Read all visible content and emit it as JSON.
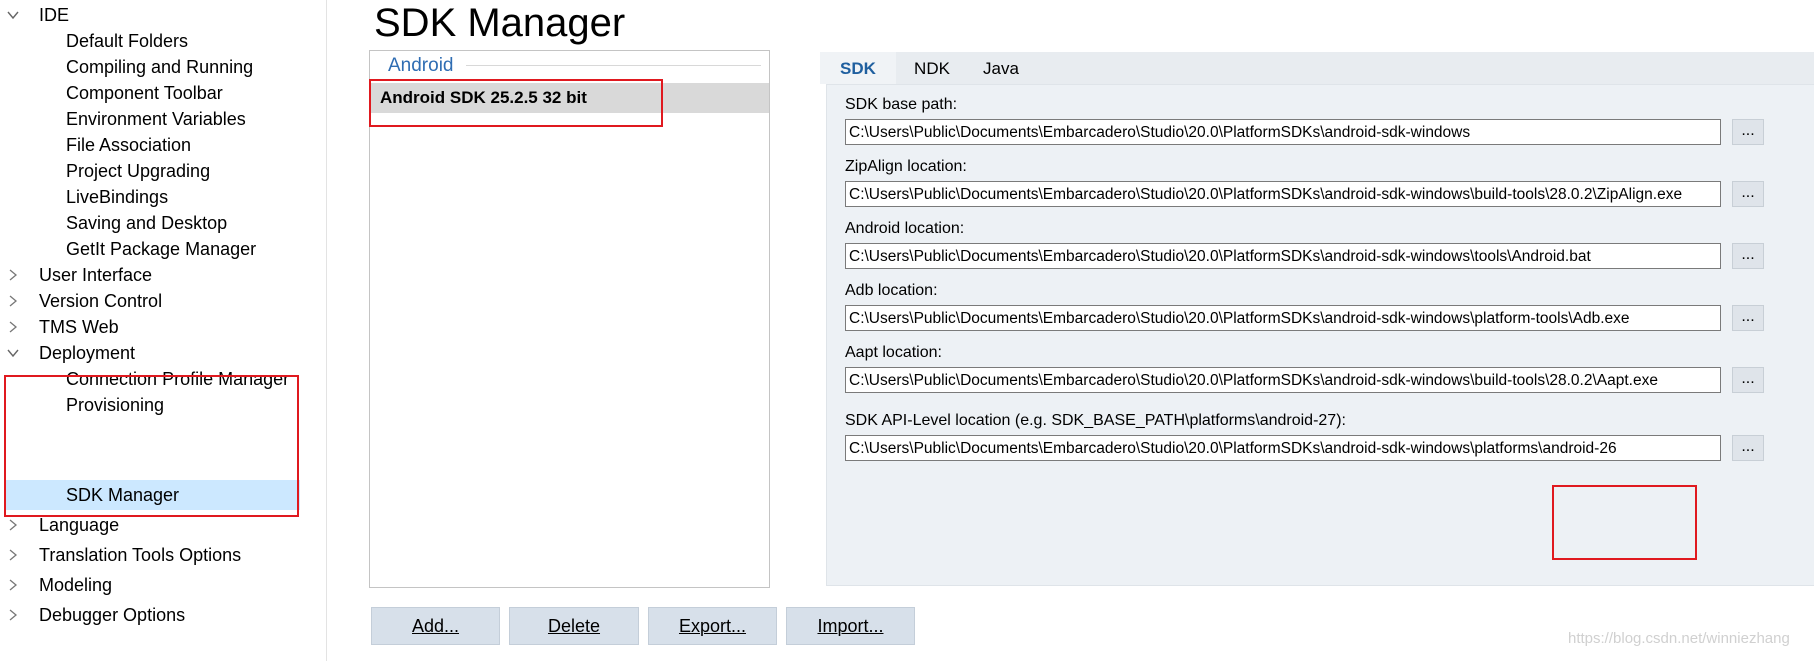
{
  "tree": {
    "items": [
      {
        "label": "IDE",
        "level": 0,
        "expanded": true
      },
      {
        "label": "Default Folders",
        "level": 1
      },
      {
        "label": "Compiling and Running",
        "level": 1
      },
      {
        "label": "Component Toolbar",
        "level": 1
      },
      {
        "label": "Environment Variables",
        "level": 1
      },
      {
        "label": "File Association",
        "level": 1
      },
      {
        "label": "Project Upgrading",
        "level": 1
      },
      {
        "label": "LiveBindings",
        "level": 1
      },
      {
        "label": "Saving and Desktop",
        "level": 1
      },
      {
        "label": "GetIt Package Manager",
        "level": 1
      },
      {
        "label": "User Interface",
        "level": 0,
        "expanded": false
      },
      {
        "label": "Version Control",
        "level": 0,
        "expanded": false
      },
      {
        "label": "TMS Web",
        "level": 0,
        "expanded": false
      },
      {
        "label": "Deployment",
        "level": 0,
        "expanded": true
      },
      {
        "label": "Connection Profile Manager",
        "level": 1
      },
      {
        "label": "Provisioning",
        "level": 1
      },
      {
        "label": "SDK Manager",
        "level": 1,
        "selected": true
      },
      {
        "label": "Language",
        "level": 0,
        "expanded": false
      },
      {
        "label": "Translation Tools Options",
        "level": 0,
        "expanded": false
      },
      {
        "label": "Modeling",
        "level": 0,
        "expanded": false
      },
      {
        "label": "Debugger Options",
        "level": 0,
        "expanded": false
      }
    ]
  },
  "page": {
    "title": "SDK Manager"
  },
  "sdk_list": {
    "group": "Android",
    "items": [
      "Android SDK 25.2.5 32 bit"
    ]
  },
  "tabs": [
    "SDK",
    "NDK",
    "Java"
  ],
  "active_tab": "SDK",
  "fields": [
    {
      "label": "SDK base path:",
      "value": "C:\\Users\\Public\\Documents\\Embarcadero\\Studio\\20.0\\PlatformSDKs\\android-sdk-windows",
      "browse": "..."
    },
    {
      "label": "ZipAlign location:",
      "value": "C:\\Users\\Public\\Documents\\Embarcadero\\Studio\\20.0\\PlatformSDKs\\android-sdk-windows\\build-tools\\28.0.2\\ZipAlign.exe",
      "browse": "..."
    },
    {
      "label": "Android location:",
      "value": "C:\\Users\\Public\\Documents\\Embarcadero\\Studio\\20.0\\PlatformSDKs\\android-sdk-windows\\tools\\Android.bat",
      "browse": "..."
    },
    {
      "label": "Adb location:",
      "value": "C:\\Users\\Public\\Documents\\Embarcadero\\Studio\\20.0\\PlatformSDKs\\android-sdk-windows\\platform-tools\\Adb.exe",
      "browse": "..."
    },
    {
      "label": "Aapt location:",
      "value": "C:\\Users\\Public\\Documents\\Embarcadero\\Studio\\20.0\\PlatformSDKs\\android-sdk-windows\\build-tools\\28.0.2\\Aapt.exe",
      "browse": "..."
    },
    {
      "label": "SDK API-Level location (e.g. SDK_BASE_PATH\\platforms\\android-27):",
      "value": "C:\\Users\\Public\\Documents\\Embarcadero\\Studio\\20.0\\PlatformSDKs\\android-sdk-windows\\platforms\\android-26",
      "browse": "..."
    }
  ],
  "buttons": {
    "add": "Add...",
    "delete": "Delete",
    "export": "Export...",
    "import": "Import..."
  },
  "watermark": "https://blog.csdn.net/winniezhang",
  "colors": {
    "selection": "#cce8ff",
    "accent": "#2f6db3",
    "highlight_box": "#e0191f",
    "button_bg": "#d7e0ea",
    "tab_panel_bg": "#edf1f5"
  }
}
